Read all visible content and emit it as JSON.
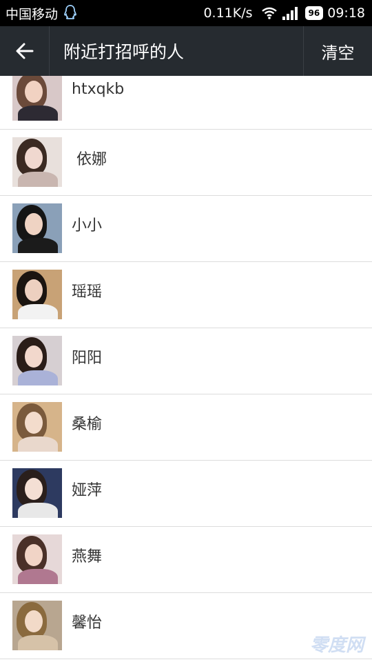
{
  "status_bar": {
    "carrier": "中国移动",
    "net_speed": "0.11K/s",
    "battery": "96",
    "time": "09:18"
  },
  "header": {
    "title": "附近打招呼的人",
    "clear_label": "清空"
  },
  "list": [
    {
      "name": "htxqkb",
      "hair": "#6b4a3a",
      "face": "#f1d2c2",
      "body": "#2d2a33",
      "bg": "#d8c8c8"
    },
    {
      "name": " 依娜",
      "hair": "#3b2a22",
      "face": "#f0d8cf",
      "body": "#c9b6b0",
      "bg": "#e8e0dc"
    },
    {
      "name": "小小",
      "hair": "#151515",
      "face": "#efd3c3",
      "body": "#1b1b1b",
      "bg": "#8aa0b8"
    },
    {
      "name": "瑶瑶",
      "hair": "#1a1410",
      "face": "#edd0c0",
      "body": "#f2f2f2",
      "bg": "#c8a276"
    },
    {
      "name": "阳阳",
      "hair": "#2a1d18",
      "face": "#f2d8cc",
      "body": "#aab2d8",
      "bg": "#d6cfd2"
    },
    {
      "name": "桑榆",
      "hair": "#7a5a3c",
      "face": "#f3dccc",
      "body": "#e9d8cc",
      "bg": "#d6b48a"
    },
    {
      "name": "娅萍",
      "hair": "#2a1f1c",
      "face": "#f4dfd4",
      "body": "#e8e8e8",
      "bg": "#2d3a60"
    },
    {
      "name": "燕舞",
      "hair": "#4a3028",
      "face": "#f1d4c6",
      "body": "#b07890",
      "bg": "#e6d8d8"
    },
    {
      "name": "馨怡",
      "hair": "#8a6a3e",
      "face": "#f2dac8",
      "body": "#d6c2a8",
      "bg": "#b8a690"
    }
  ],
  "watermark": "零度网"
}
